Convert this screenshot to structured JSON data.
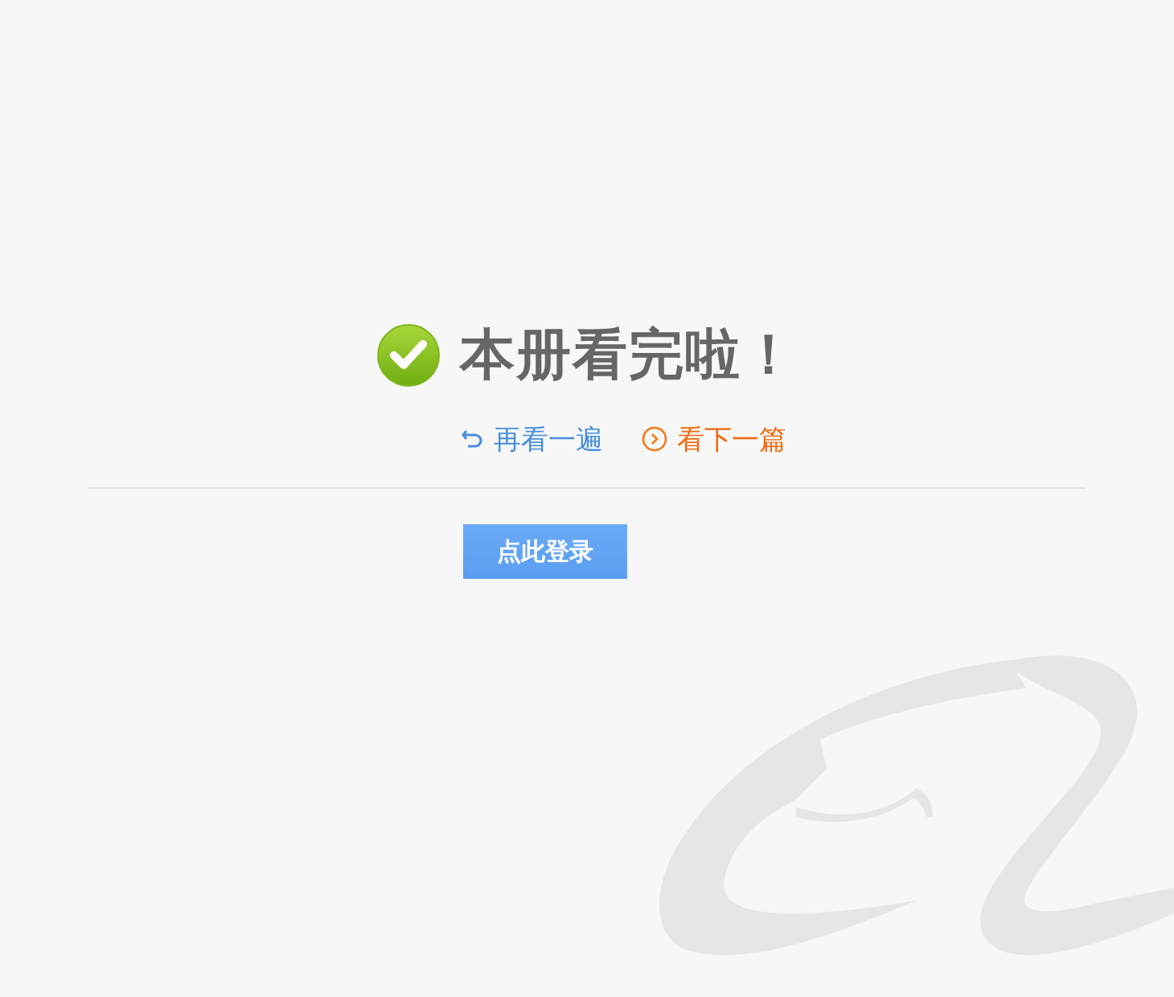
{
  "title": "本册看完啦！",
  "links": [
    {
      "kind": "replay",
      "label": "再看一遍"
    },
    {
      "kind": "next",
      "label": "看下一篇"
    }
  ],
  "login_button": "点此登录"
}
